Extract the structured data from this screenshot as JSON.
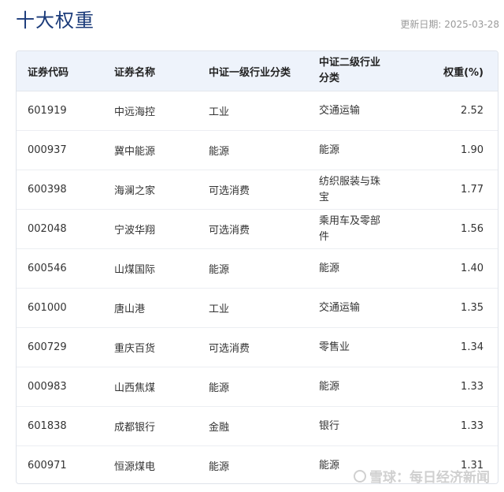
{
  "title": "十大权重",
  "update_date": "更新日期: 2025-03-28",
  "table": {
    "headers": [
      "证券代码",
      "证券名称",
      "中证一级行业分类",
      "中证二级行业分类",
      "权重(%)"
    ],
    "rows": [
      {
        "code": "601919",
        "name": "中远海控",
        "industry1": "工业",
        "industry2": "交通运输",
        "weight": "2.52"
      },
      {
        "code": "000937",
        "name": "冀中能源",
        "industry1": "能源",
        "industry2": "能源",
        "weight": "1.90"
      },
      {
        "code": "600398",
        "name": "海澜之家",
        "industry1": "可选消费",
        "industry2": "纺织服装与珠宝",
        "weight": "1.77"
      },
      {
        "code": "002048",
        "name": "宁波华翔",
        "industry1": "可选消费",
        "industry2": "乘用车及零部件",
        "weight": "1.56"
      },
      {
        "code": "600546",
        "name": "山煤国际",
        "industry1": "能源",
        "industry2": "能源",
        "weight": "1.40"
      },
      {
        "code": "601000",
        "name": "唐山港",
        "industry1": "工业",
        "industry2": "交通运输",
        "weight": "1.35"
      },
      {
        "code": "600729",
        "name": "重庆百货",
        "industry1": "可选消费",
        "industry2": "零售业",
        "weight": "1.34"
      },
      {
        "code": "000983",
        "name": "山西焦煤",
        "industry1": "能源",
        "industry2": "能源",
        "weight": "1.33"
      },
      {
        "code": "601838",
        "name": "成都银行",
        "industry1": "金融",
        "industry2": "银行",
        "weight": "1.33"
      },
      {
        "code": "600971",
        "name": "恒源煤电",
        "industry1": "能源",
        "industry2": "能源",
        "weight": "1.31"
      }
    ]
  },
  "watermark": "雪球：每日经济新闻"
}
